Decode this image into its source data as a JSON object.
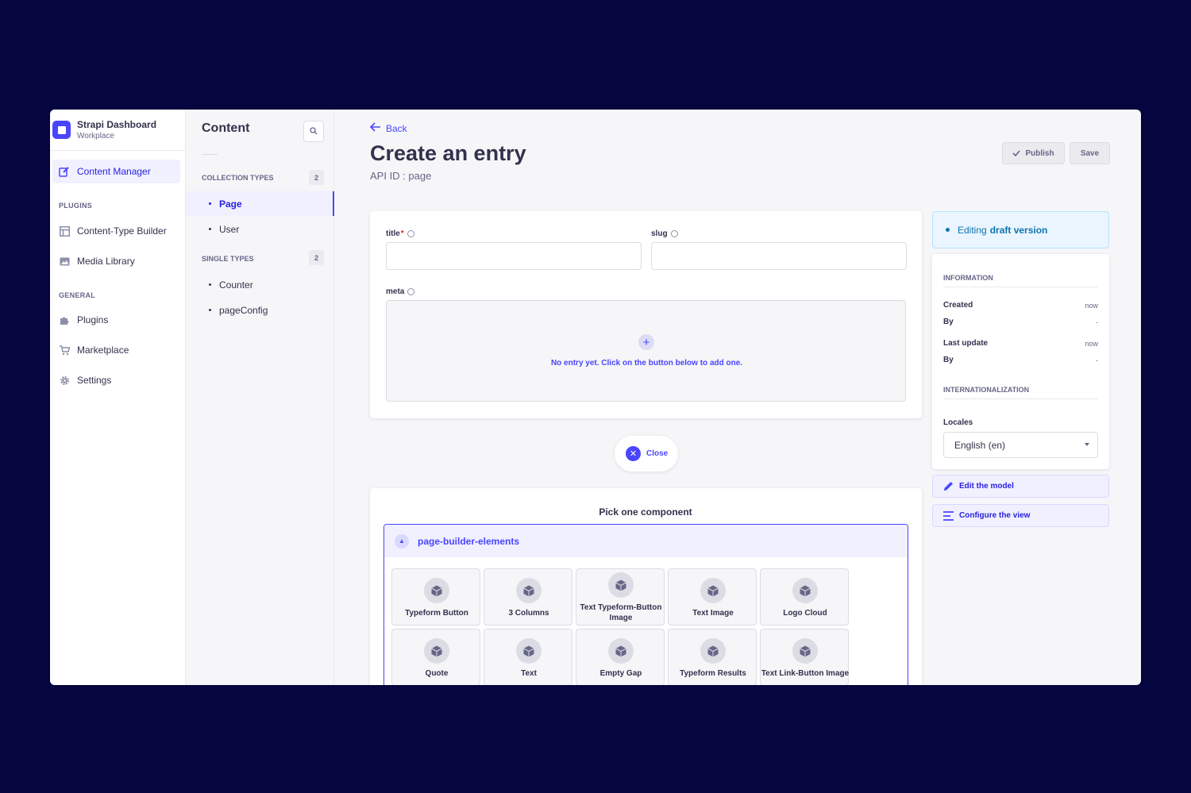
{
  "brand": {
    "title": "Strapi Dashboard",
    "subtitle": "Workplace"
  },
  "mainnav": {
    "content_manager": "Content Manager",
    "plugins_section": "PLUGINS",
    "content_type_builder": "Content-Type Builder",
    "media_library": "Media Library",
    "general_section": "GENERAL",
    "plugins": "Plugins",
    "marketplace": "Marketplace",
    "settings": "Settings"
  },
  "subnav": {
    "title": "Content",
    "collection_types": {
      "label": "COLLECTION TYPES",
      "count": "2",
      "items": [
        "Page",
        "User"
      ]
    },
    "single_types": {
      "label": "SINGLE TYPES",
      "count": "2",
      "items": [
        "Counter",
        "pageConfig"
      ]
    }
  },
  "header": {
    "back": "Back",
    "title": "Create an entry",
    "api_id": "API ID : page",
    "publish": "Publish",
    "save": "Save"
  },
  "form": {
    "title_label": "title",
    "required_mark": "*",
    "slug_label": "slug",
    "meta_label": "meta",
    "meta_empty": "No entry yet. Click on the button below to add one.",
    "close": "Close"
  },
  "picker": {
    "title": "Pick one component",
    "category": "page-builder-elements",
    "components": [
      "Typeform Button",
      "3 Columns",
      "Text Typeform-Button Image",
      "Text Image",
      "Logo Cloud",
      "Quote",
      "Text",
      "Empty Gap",
      "Typeform Results",
      "Text Link-Button Image"
    ]
  },
  "sidebar": {
    "draft_prefix": "Editing",
    "draft_bold": "draft version",
    "information": "INFORMATION",
    "created": "Created",
    "created_value": "now",
    "by": "By",
    "by_value": "-",
    "last_update": "Last update",
    "last_update_value": "now",
    "internationalization": "INTERNATIONALIZATION",
    "locales_label": "Locales",
    "locale_value": "English (en)",
    "edit_model": "Edit the model",
    "configure_view": "Configure the view"
  },
  "colors": {
    "accent": "#4945ff",
    "background": "#05053f",
    "info": "#0c75af"
  }
}
